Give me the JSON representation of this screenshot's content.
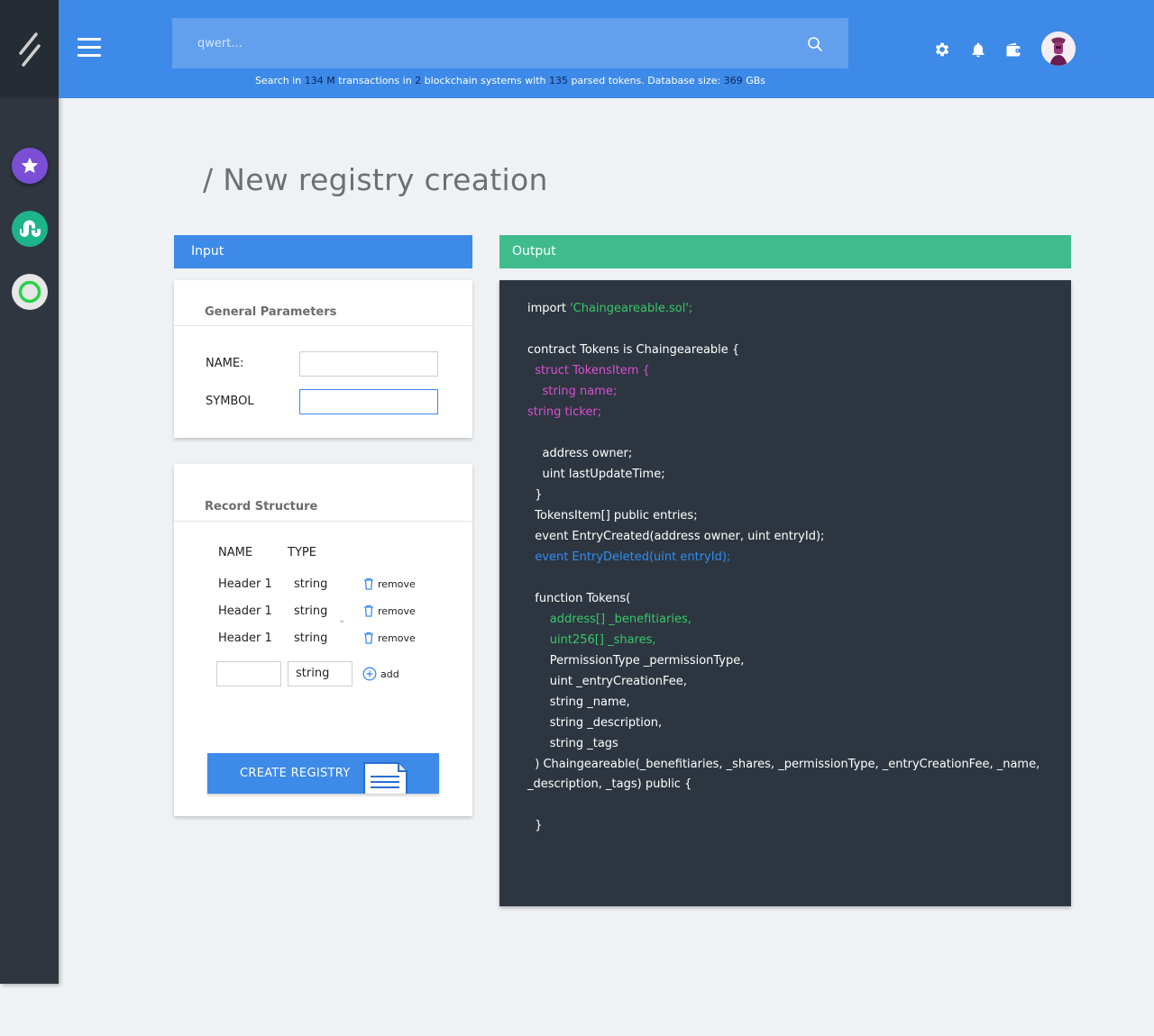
{
  "header": {
    "search_placeholder": "qwert...",
    "stats": {
      "prefix": "Search in",
      "transactions": "134 M",
      "mid1": "transactions in",
      "systems": "2",
      "mid2": "blockchain systems with",
      "tokens": "135",
      "mid3": "parsed tokens. Database size:",
      "db_size": "369",
      "suffix": "GBs"
    }
  },
  "page": {
    "title": "/ New registry creation"
  },
  "panels": {
    "input_label": "Input",
    "output_label": "Output"
  },
  "general": {
    "title": "General Parameters",
    "name_label": "NAME:",
    "name_value": "",
    "symbol_label": "SYMBOL",
    "symbol_value": ""
  },
  "records": {
    "title": "Record Structure",
    "col_name": "NAME",
    "col_type": "TYPE",
    "rows": [
      {
        "name": "Header 1",
        "type": "string",
        "action": "remove"
      },
      {
        "name": "Header 1",
        "type": "string",
        "action": "remove"
      },
      {
        "name": "Header 1",
        "type": "string",
        "action": "remove"
      }
    ],
    "new_name": "",
    "new_type": "string",
    "add_label": "add",
    "create_label": "CREATE REGISTRY"
  },
  "code": {
    "l1a": "import ",
    "l1b": "'Chaingeareable.sol';",
    "l2": "contract Tokens is Chaingeareable {",
    "l3": "  struct TokensItem {",
    "l4": "    string name;",
    "l5": "string ticker;",
    "l6": "    address owner;",
    "l7": "    uint lastUpdateTime;",
    "l8": "  }",
    "l9": "  TokensItem[] public entries;",
    "l10": "  event EntryCreated(address owner, uint entryId);",
    "l11": "  event EntryDeleted(uint entryId);",
    "l12": "  function Tokens(",
    "l13": "      address[] _benefitiaries,",
    "l14": "      uint256[] _shares,",
    "l15": "      PermissionType _permissionType,",
    "l16": "      uint _entryCreationFee,",
    "l17": "      string _name,",
    "l18": "      string _description,",
    "l19": "      string _tags",
    "l20": "  ) Chaingeareable(_benefitiaries, _shares, _permissionType, _entryCreationFee, _name,",
    "l21": "_description, _tags) public {",
    "l22": "  }"
  },
  "colors": {
    "primary": "#3d8ae8",
    "output": "#40bb8e",
    "sidebar": "#2f3640",
    "code_bg": "#2d3640",
    "code_green": "#37c86a",
    "code_pink": "#d94fd3",
    "code_blue": "#2f8cf0"
  },
  "icons": [
    "logo-icon",
    "menu-icon",
    "search-icon",
    "gear-icon",
    "bell-icon",
    "wallet-icon",
    "star-icon",
    "stumbleupon-icon",
    "ring-icon",
    "trash-icon",
    "plus-circle-icon",
    "document-icon"
  ]
}
